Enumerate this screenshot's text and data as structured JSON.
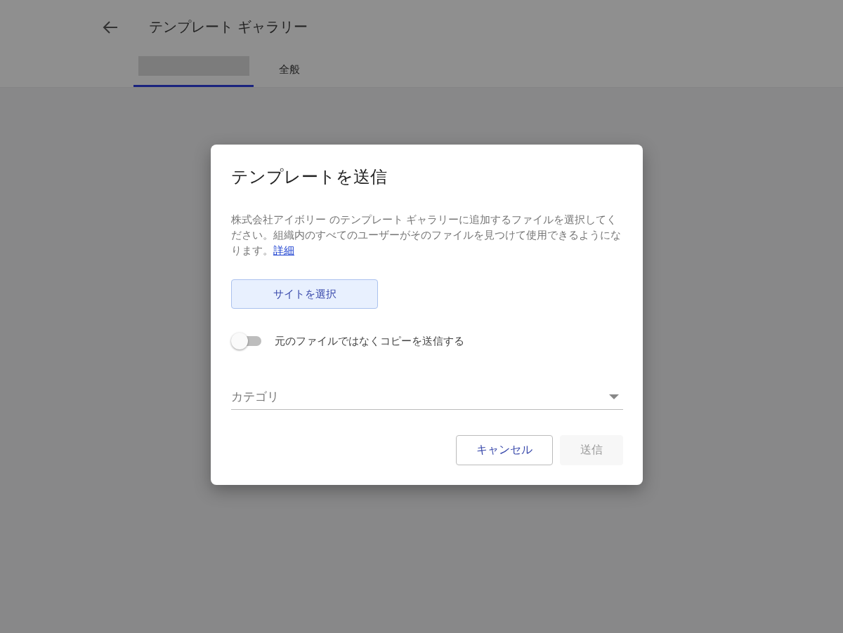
{
  "header": {
    "title": "テンプレート ギャラリー"
  },
  "tabs": [
    {
      "kind": "redacted",
      "selected": true
    },
    {
      "kind": "text",
      "label": "全般",
      "selected": false
    }
  ],
  "dialog": {
    "title": "テンプレートを送信",
    "description": "株式会社アイボリー のテンプレート ギャラリーに追加するファイルを選択してください。組織内のすべてのユーザーがそのファイルを見つけて使用できるようになります。",
    "link": "詳細",
    "select_button": "サイトを選択",
    "toggle": {
      "label": "元のファイルではなくコピーを送信する",
      "on": false
    },
    "category": {
      "placeholder": "カテゴリ"
    },
    "buttons": [
      {
        "label": "キャンセル",
        "disabled": false
      },
      {
        "label": "送信",
        "disabled": true
      }
    ]
  }
}
